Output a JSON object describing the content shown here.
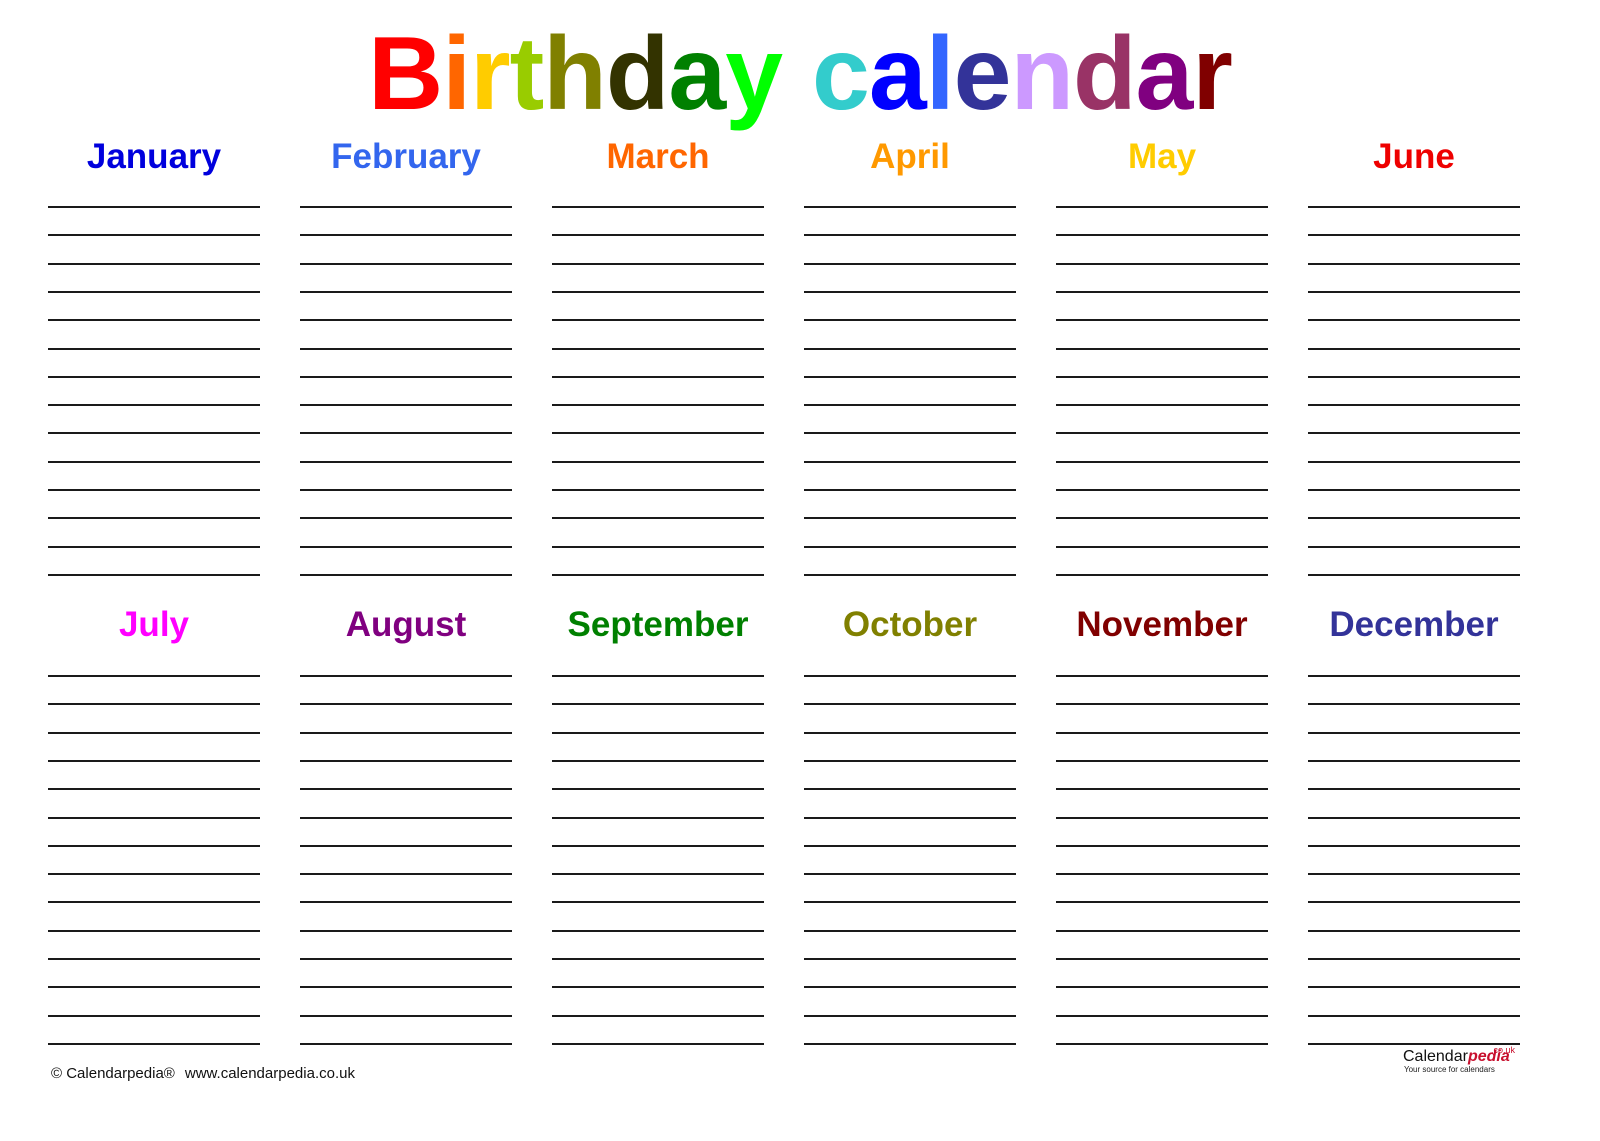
{
  "title": {
    "text": "Birthday calendar",
    "letters": [
      {
        "ch": "B",
        "color": "#ff0000"
      },
      {
        "ch": "i",
        "color": "#ff6600"
      },
      {
        "ch": "r",
        "color": "#ffcc00"
      },
      {
        "ch": "t",
        "color": "#99cc00"
      },
      {
        "ch": "h",
        "color": "#808000"
      },
      {
        "ch": "d",
        "color": "#333300"
      },
      {
        "ch": "a",
        "color": "#008000"
      },
      {
        "ch": "y",
        "color": "#00ff00"
      },
      {
        "ch": " ",
        "color": "#ffffff"
      },
      {
        "ch": "c",
        "color": "#33cccc"
      },
      {
        "ch": "a",
        "color": "#0000ff"
      },
      {
        "ch": "l",
        "color": "#3366ff"
      },
      {
        "ch": "e",
        "color": "#333399"
      },
      {
        "ch": "n",
        "color": "#cc99ff"
      },
      {
        "ch": "d",
        "color": "#993366"
      },
      {
        "ch": "a",
        "color": "#800080"
      },
      {
        "ch": "r",
        "color": "#800000"
      }
    ]
  },
  "months": [
    {
      "name": "January",
      "color": "#0000dd"
    },
    {
      "name": "February",
      "color": "#3366ee"
    },
    {
      "name": "March",
      "color": "#ff6600"
    },
    {
      "name": "April",
      "color": "#ff9900"
    },
    {
      "name": "May",
      "color": "#ffcc00"
    },
    {
      "name": "June",
      "color": "#ee0000"
    },
    {
      "name": "July",
      "color": "#ff00ff"
    },
    {
      "name": "August",
      "color": "#800080"
    },
    {
      "name": "September",
      "color": "#008000"
    },
    {
      "name": "October",
      "color": "#808000"
    },
    {
      "name": "November",
      "color": "#800000"
    },
    {
      "name": "December",
      "color": "#333399"
    }
  ],
  "lines_per_month": 14,
  "footer": {
    "copyright": "© Calendarpedia®",
    "url": "www.calendarpedia.co.uk"
  },
  "logo": {
    "brand_plain": "Calendar",
    "brand_accent": "pedia",
    "domain_suffix": ".co.uk",
    "tagline": "Your source for calendars"
  }
}
